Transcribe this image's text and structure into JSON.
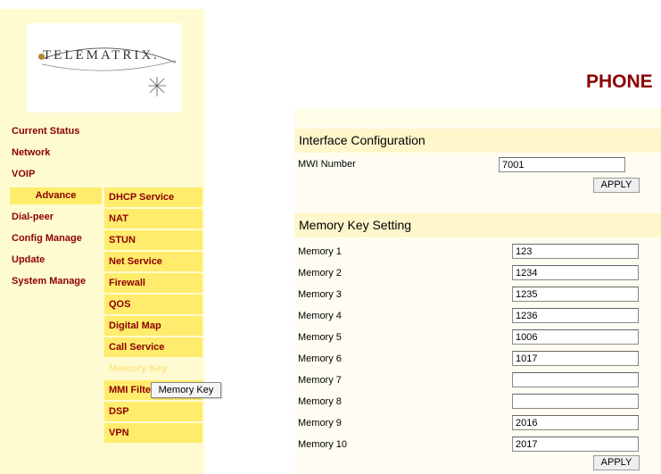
{
  "logo": {
    "text": "TELEMATRIX."
  },
  "page_title": "PHONE",
  "nav": {
    "main": [
      "Current Status",
      "Network",
      "VOIP"
    ],
    "advance": "Advance",
    "lower": [
      "Dial-peer",
      "Config Manage",
      "Update",
      "System Manage"
    ],
    "sub": [
      "DHCP Service",
      "NAT",
      "STUN",
      "Net Service",
      "Firewall",
      "QOS",
      "Digital Map",
      "Call Service",
      "Memory Key",
      "MMI Filter",
      "DSP",
      "VPN"
    ]
  },
  "tooltip": "Memory Key",
  "interface": {
    "heading": "Interface Configuration",
    "mwi_label": "MWI Number",
    "mwi_value": "7001",
    "apply": "APPLY"
  },
  "memory": {
    "heading": "Memory Key Setting",
    "rows": [
      {
        "label": "Memory 1",
        "value": "123"
      },
      {
        "label": "Memory 2",
        "value": "1234"
      },
      {
        "label": "Memory 3",
        "value": "1235"
      },
      {
        "label": "Memory 4",
        "value": "1236"
      },
      {
        "label": "Memory 5",
        "value": "1006"
      },
      {
        "label": "Memory 6",
        "value": "1017"
      },
      {
        "label": "Memory 7",
        "value": ""
      },
      {
        "label": "Memory 8",
        "value": ""
      },
      {
        "label": "Memory 9",
        "value": "2016"
      },
      {
        "label": "Memory 10",
        "value": "2017"
      }
    ],
    "apply": "APPLY"
  }
}
